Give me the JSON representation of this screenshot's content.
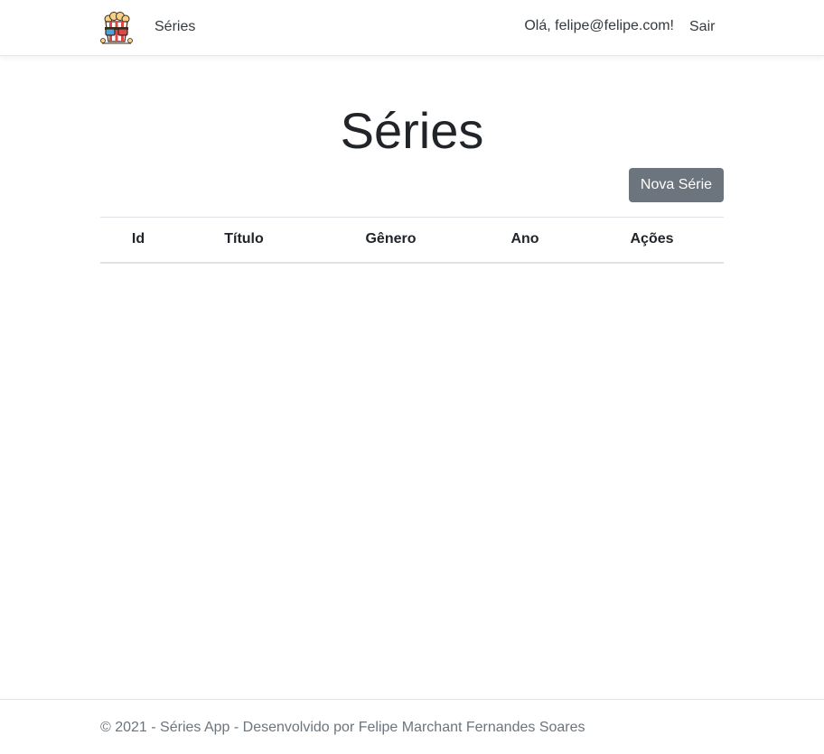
{
  "navbar": {
    "logo_icon": "popcorn-3d-glasses-icon",
    "brand_link": "Séries",
    "greeting": "Olá, felipe@felipe.com!",
    "logout": "Sair"
  },
  "main": {
    "title": "Séries",
    "new_button": "Nova Série",
    "table": {
      "columns": [
        "Id",
        "Título",
        "Gênero",
        "Ano",
        "Ações"
      ],
      "rows": []
    }
  },
  "footer": {
    "text": "© 2021 - Séries App - Desenvolvido por Felipe Marchant Fernandes Soares"
  },
  "colors": {
    "button_bg": "#6c757d",
    "text": "#212529",
    "muted": "#6c757d"
  }
}
